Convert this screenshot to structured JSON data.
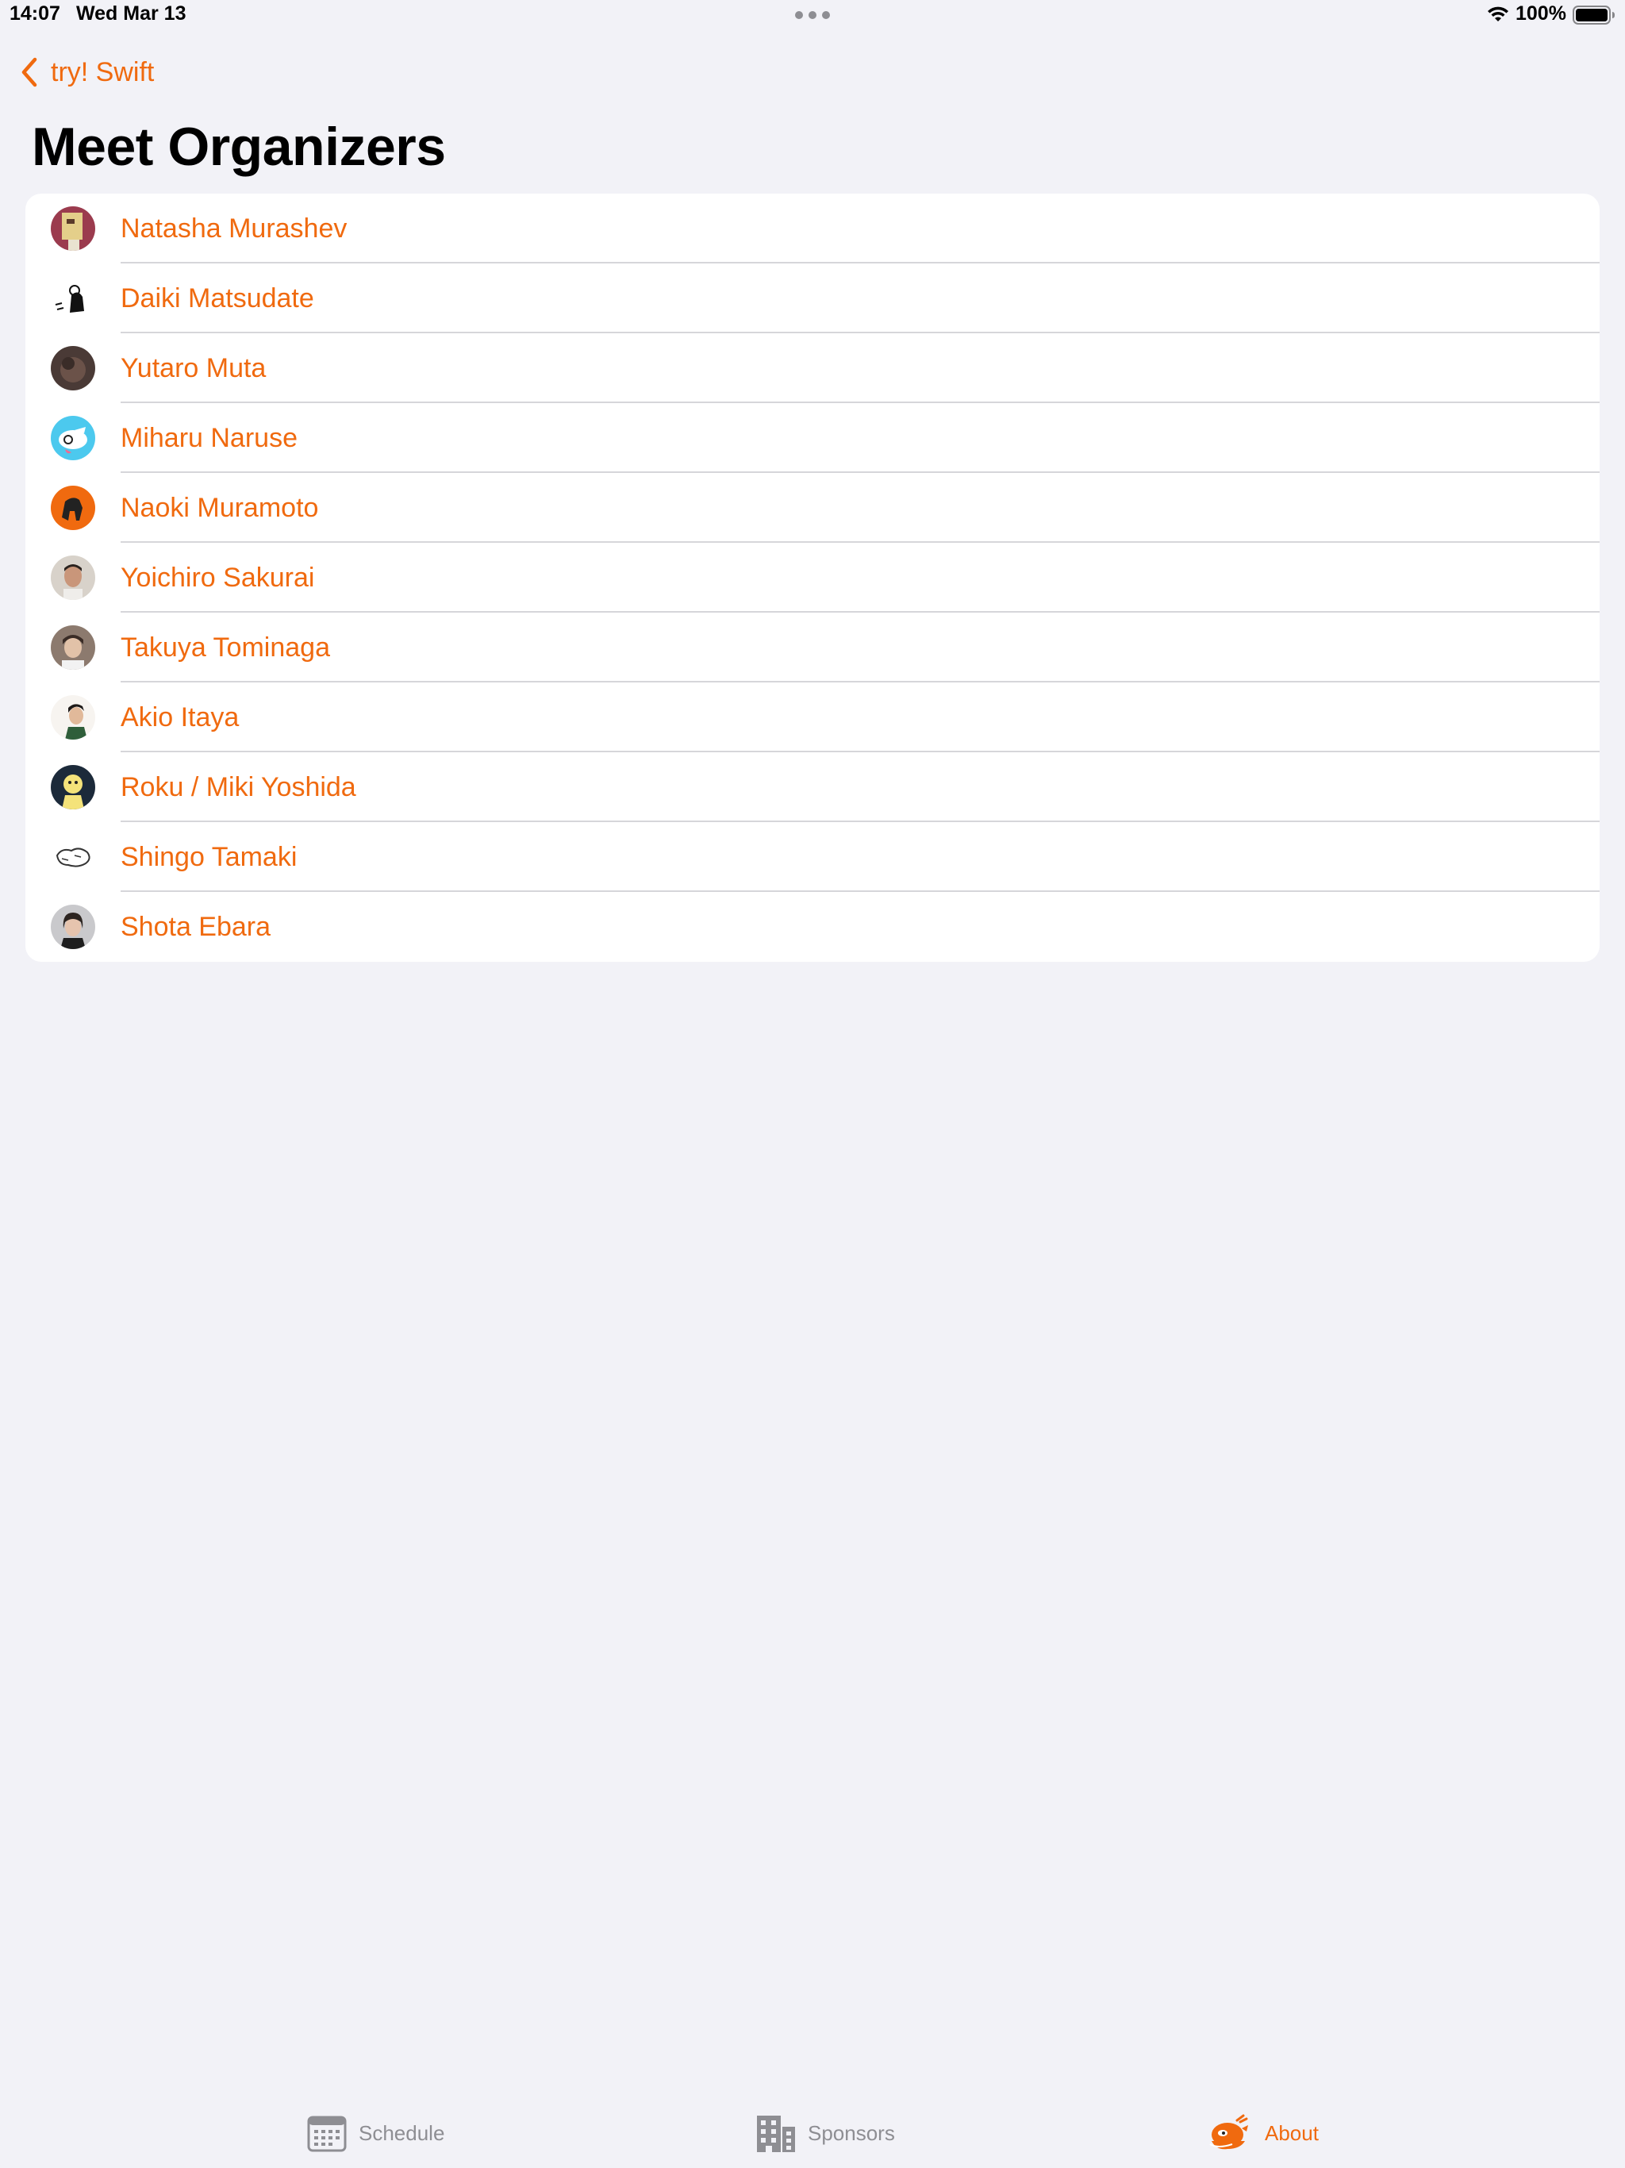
{
  "status_bar": {
    "time": "14:07",
    "date": "Wed Mar 13",
    "battery_percent": "100%",
    "battery_level": 1.0
  },
  "nav": {
    "back_label": "try! Swift",
    "back_icon": "chevron-left-icon",
    "title": "Meet Organizers"
  },
  "organizers": [
    {
      "name": "Natasha Murashev"
    },
    {
      "name": "Daiki Matsudate"
    },
    {
      "name": "Yutaro Muta"
    },
    {
      "name": "Miharu Naruse"
    },
    {
      "name": "Naoki Muramoto"
    },
    {
      "name": "Yoichiro Sakurai"
    },
    {
      "name": "Takuya Tominaga"
    },
    {
      "name": "Akio Itaya"
    },
    {
      "name": "Roku / Miki Yoshida"
    },
    {
      "name": "Shingo Tamaki"
    },
    {
      "name": "Shota Ebara"
    }
  ],
  "tab_bar": {
    "tabs": [
      {
        "label": "Schedule",
        "icon": "calendar-icon",
        "active": false
      },
      {
        "label": "Sponsors",
        "icon": "building-icon",
        "active": false
      },
      {
        "label": "About",
        "icon": "bird-mascot-icon",
        "active": true
      }
    ]
  },
  "colors": {
    "accent": "#F06A0F",
    "background": "#F2F2F7",
    "inactive": "#8E8E93"
  }
}
